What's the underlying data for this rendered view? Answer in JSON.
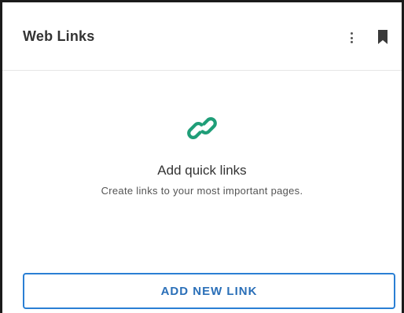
{
  "widget": {
    "title": "Web Links",
    "menu_icon": "more-vertical-icon",
    "bookmark_icon": "bookmark-icon"
  },
  "empty_state": {
    "icon": "link-icon",
    "icon_color": "#1f9e78",
    "title": "Add quick links",
    "description": "Create links to your most important pages."
  },
  "actions": {
    "add_link_label": "ADD NEW LINK",
    "accent_color": "#2a7fd4"
  }
}
